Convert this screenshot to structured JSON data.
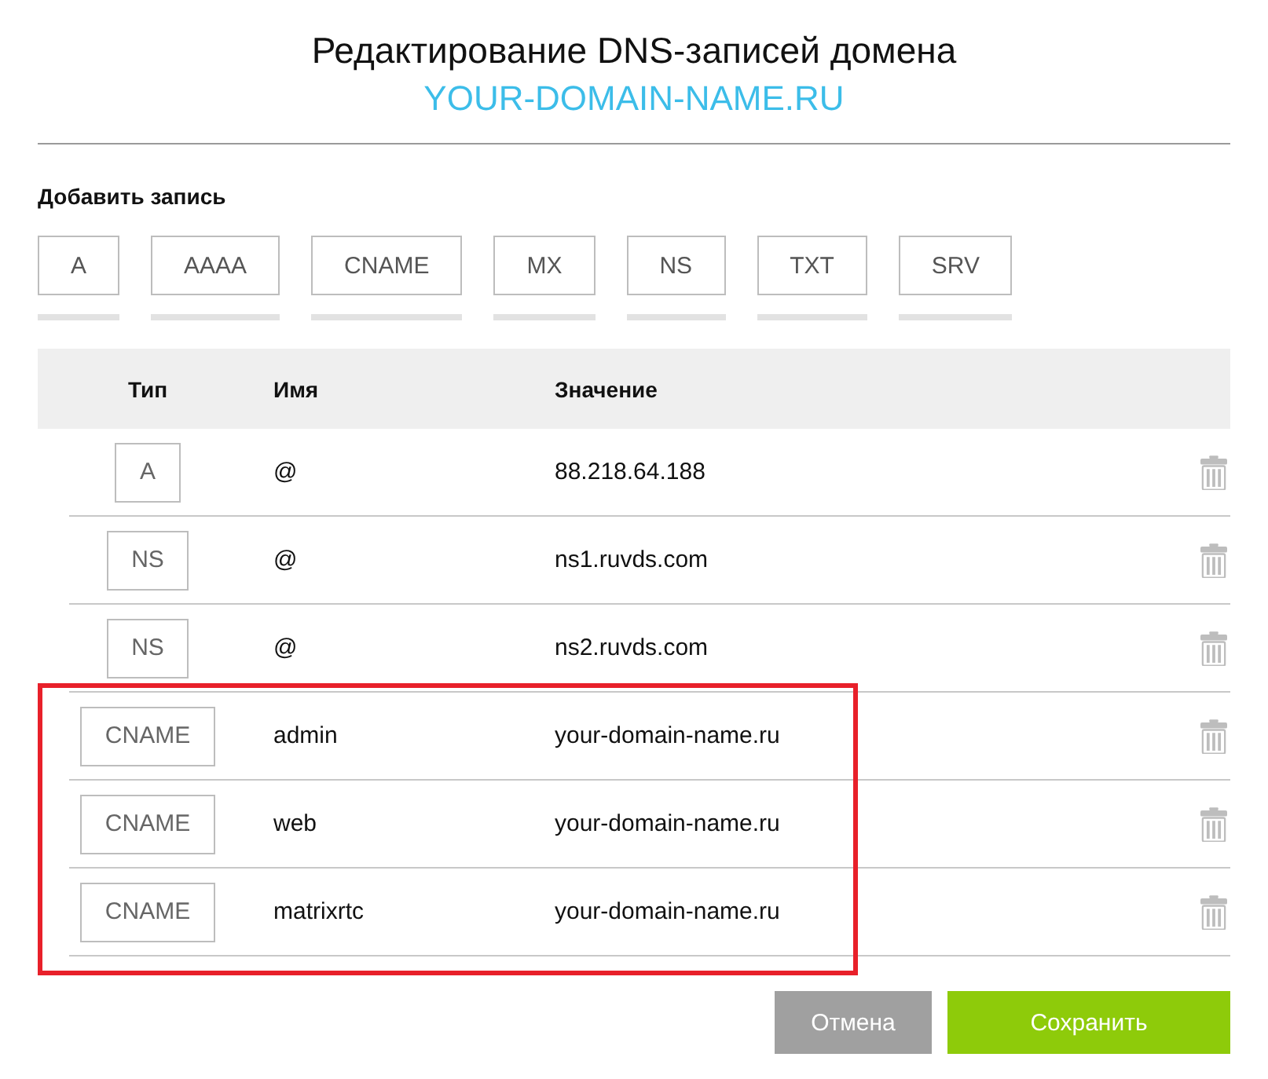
{
  "dialog": {
    "title": "Редактирование DNS-записей домена",
    "domain": "YOUR-DOMAIN-NAME.RU"
  },
  "add_record": {
    "label": "Добавить запись",
    "types": [
      "A",
      "AAAA",
      "CNAME",
      "MX",
      "NS",
      "TXT",
      "SRV"
    ]
  },
  "table": {
    "columns": [
      "Тип",
      "Имя",
      "Значение"
    ],
    "rows": [
      {
        "type": "A",
        "name": "@",
        "value": "88.218.64.188",
        "highlighted": false
      },
      {
        "type": "NS",
        "name": "@",
        "value": "ns1.ruvds.com",
        "highlighted": false
      },
      {
        "type": "NS",
        "name": "@",
        "value": "ns2.ruvds.com",
        "highlighted": false
      },
      {
        "type": "CNAME",
        "name": "admin",
        "value": "your-domain-name.ru",
        "highlighted": true
      },
      {
        "type": "CNAME",
        "name": "web",
        "value": "your-domain-name.ru",
        "highlighted": true
      },
      {
        "type": "CNAME",
        "name": "matrixrtc",
        "value": "your-domain-name.ru",
        "highlighted": true
      }
    ]
  },
  "buttons": [
    {
      "label": "Отмена",
      "kind": "secondary"
    },
    {
      "label": "Сохранить",
      "kind": "primary"
    }
  ]
}
